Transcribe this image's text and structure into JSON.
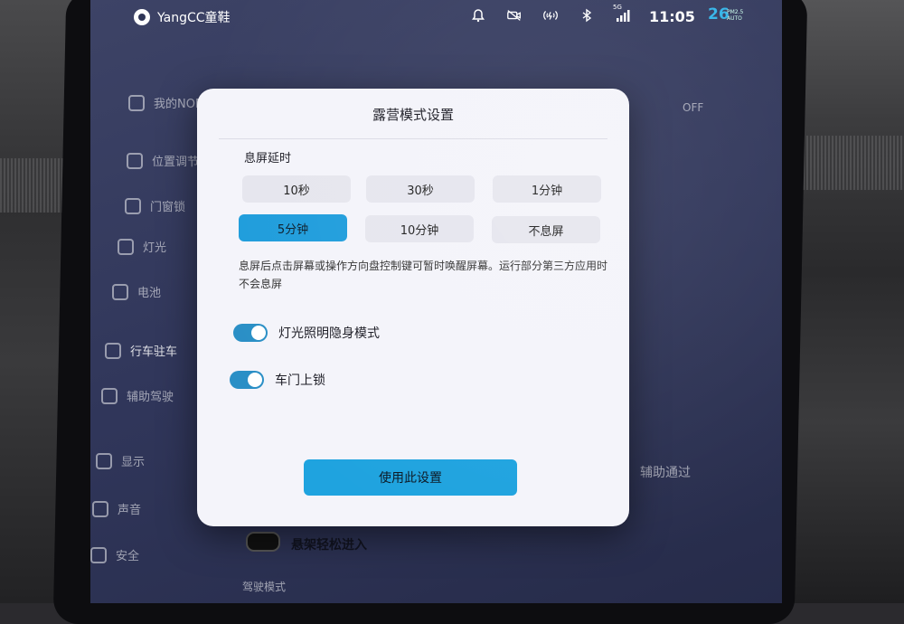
{
  "statusbar": {
    "brand": "YangCC童鞋",
    "icons": [
      "bell-icon",
      "camera-off-icon",
      "wireless-charging-icon",
      "bluetooth-icon",
      "signal-5g-icon"
    ],
    "signal_label": "5G",
    "time": "11:05",
    "temperature": "26",
    "temp_sub_1": "PM2.5",
    "temp_sub_2": "AUTO"
  },
  "bg_menu": {
    "items": [
      {
        "label": "我的NOMI"
      },
      {
        "label": "位置调节"
      },
      {
        "label": "门窗锁"
      },
      {
        "label": "灯光"
      },
      {
        "label": "电池"
      },
      {
        "label": "行车驻车"
      },
      {
        "label": "辅助驾驶"
      },
      {
        "label": "显示"
      },
      {
        "label": "声音"
      },
      {
        "label": "安全"
      }
    ],
    "right_text": "辅助通过",
    "bottom_toggle_label": "悬架轻松进入",
    "bottom_text": "驾驶模式",
    "top_right_text": "OFF"
  },
  "dialog": {
    "title": "露营模式设置",
    "section_label": "息屏延时",
    "options": [
      "10秒",
      "30秒",
      "1分钟",
      "5分钟",
      "10分钟",
      "不息屏"
    ],
    "selected_option": "5分钟",
    "description": "息屏后点击屏幕或操作方向盘控制键可暂时唤醒屏幕。运行部分第三方应用时不会息屏",
    "toggles": [
      {
        "label": "灯光照明隐身模式",
        "on": true
      },
      {
        "label": "车门上锁",
        "on": true
      }
    ],
    "apply_label": "使用此设置"
  },
  "colors": {
    "accent": "#1fa3df",
    "dialog_bg": "#f4f4fa",
    "screen_bg": "#30365a"
  }
}
